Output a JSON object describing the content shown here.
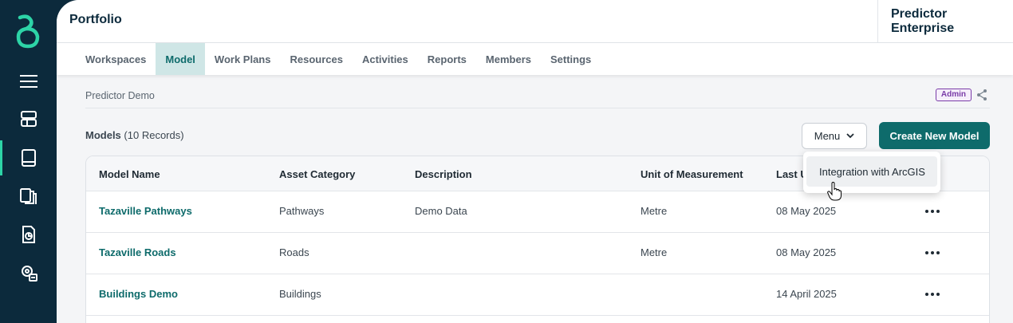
{
  "header": {
    "title": "Portfolio",
    "product": "Predictor Enterprise"
  },
  "tabs": [
    {
      "label": "Workspaces"
    },
    {
      "label": "Model"
    },
    {
      "label": "Work Plans"
    },
    {
      "label": "Resources"
    },
    {
      "label": "Activities"
    },
    {
      "label": "Reports"
    },
    {
      "label": "Members"
    },
    {
      "label": "Settings"
    }
  ],
  "breadcrumb": "Predictor Demo",
  "role_badge": "Admin",
  "models": {
    "title": "Models",
    "count_text": "(10 Records)"
  },
  "menu": {
    "label": "Menu",
    "items": [
      "Integration with ArcGIS"
    ]
  },
  "create_button": "Create New Model",
  "table": {
    "columns": [
      "Model Name",
      "Asset Category",
      "Description",
      "Unit of Measurement",
      "Last U"
    ],
    "rows": [
      {
        "name": "Tazaville Pathways",
        "category": "Pathways",
        "description": "Demo Data",
        "unit": "Metre",
        "updated": "08 May 2025"
      },
      {
        "name": "Tazaville Roads",
        "category": "Roads",
        "description": "",
        "unit": "Metre",
        "updated": "08 May 2025"
      },
      {
        "name": "Buildings Demo",
        "category": "Buildings",
        "description": "",
        "unit": "",
        "updated": "14 April 2025"
      }
    ]
  },
  "colors": {
    "sidebar": "#0c2a3c",
    "accent": "#0e6b6b",
    "logo": "#2dd4a7",
    "badge": "#7a3ca8"
  },
  "sidebar_icons": [
    "logo-icon",
    "hamburger-icon",
    "workspace-icon",
    "book-icon",
    "documents-icon",
    "report-icon",
    "settings-icon"
  ]
}
